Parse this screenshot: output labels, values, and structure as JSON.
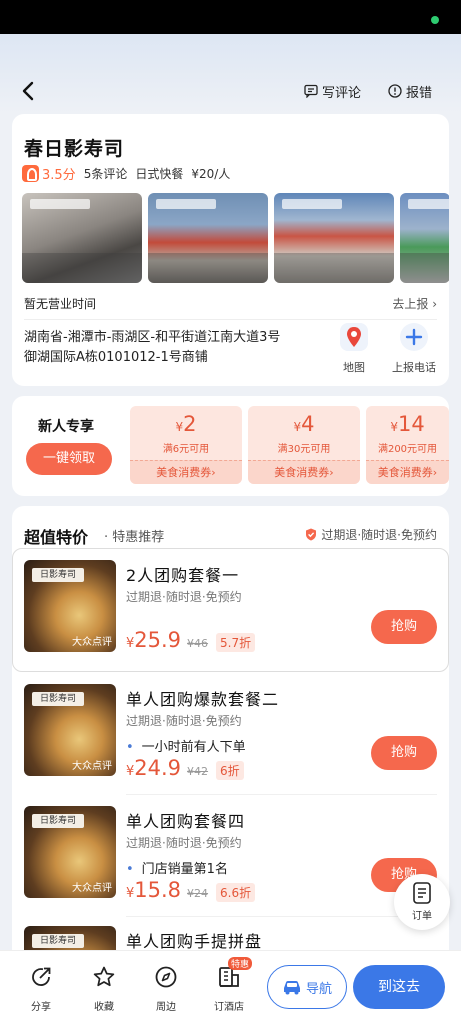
{
  "header": {
    "write_review_label": "写评论",
    "report_error_label": "报错"
  },
  "shop": {
    "name": "春日影寿司",
    "score": "3.5分",
    "review_count": "5条评论",
    "category": "日式快餐",
    "avg_price": "¥20/人",
    "hours": "暂无营业时间",
    "report_link": "去上报 ›",
    "address_line1": "湖南省-湘潭市-雨湖区-和平街道江南大道3号",
    "address_line2": "御湖国际A栋0101012-1号商铺",
    "map_label": "地图",
    "phone_label": "上报电话"
  },
  "promo": {
    "title": "新人专享",
    "claim_label": "一键领取",
    "coupons": [
      {
        "currency": "¥",
        "amount": "2",
        "condition": "满6元可用",
        "type": "美食消费券›"
      },
      {
        "currency": "¥",
        "amount": "4",
        "condition": "满30元可用",
        "type": "美食消费券›"
      },
      {
        "currency": "¥",
        "amount": "14",
        "condition": "满200元可用",
        "type": "美食消费券›"
      }
    ]
  },
  "deals": {
    "heading": "超值特价",
    "subheading": "· 特惠推荐",
    "guarantee": "过期退·随时退·免预约",
    "image_logo": "日影寿司",
    "image_watermark": "大众点评",
    "buy_label": "抢购",
    "items": [
      {
        "title": "2人团购套餐一",
        "terms": "过期退·随时退·免预约",
        "tag": "",
        "currency": "¥",
        "price": "25.9",
        "old_price": "¥46",
        "discount": "5.7折"
      },
      {
        "title": "单人团购爆款套餐二",
        "terms": "过期退·随时退·免预约",
        "tag": "一小时前有人下单",
        "currency": "¥",
        "price": "24.9",
        "old_price": "¥42",
        "discount": "6折"
      },
      {
        "title": "单人团购套餐四",
        "terms": "过期退·随时退·免预约",
        "tag": "门店销量第1名",
        "currency": "¥",
        "price": "15.8",
        "old_price": "¥24",
        "discount": "6.6折"
      },
      {
        "title": "单人团购手提拼盘",
        "terms": "",
        "tag": "",
        "currency": "",
        "price": "",
        "old_price": "",
        "discount": ""
      }
    ]
  },
  "fab": {
    "order_label": "订单"
  },
  "bottom_nav": {
    "share": "分享",
    "favorite": "收藏",
    "nearby": "周边",
    "hotel": "订酒店",
    "hotel_badge": "特惠",
    "navigate": "导航",
    "go_there": "到这去"
  },
  "colors": {
    "accent_orange": "#f5684d",
    "accent_blue": "#3b78e7",
    "price_red": "#e4573a"
  }
}
